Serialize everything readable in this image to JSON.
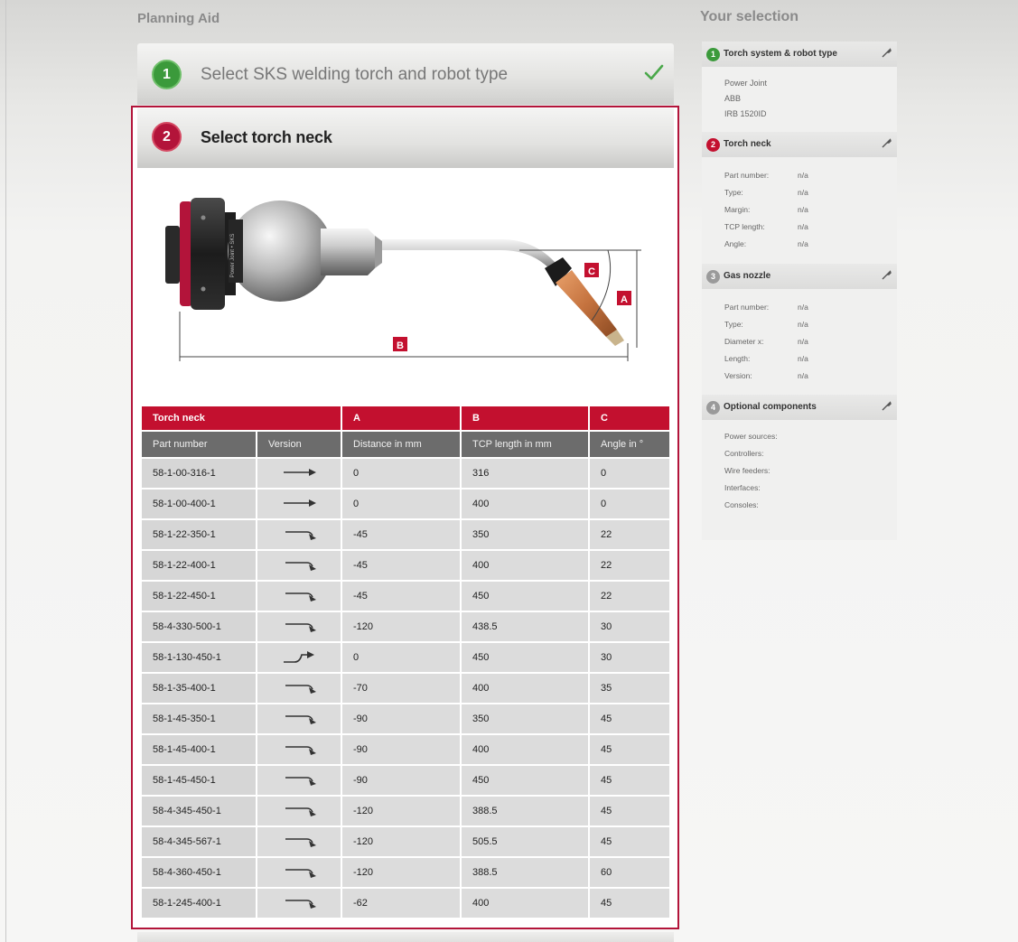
{
  "planning_aid": {
    "title": "Planning Aid"
  },
  "steps": [
    {
      "number": "1",
      "label": "Select SKS welding torch and robot type",
      "status": "completed"
    },
    {
      "number": "2",
      "label": "Select torch neck",
      "status": "active"
    }
  ],
  "diagram": {
    "labels": [
      "A",
      "B",
      "C"
    ],
    "torch_brand_text": "Power Joint • SKS"
  },
  "table": {
    "group_headers": [
      "Torch neck",
      "A",
      "B",
      "C"
    ],
    "column_headers": [
      "Part number",
      "Version",
      "Distance in mm",
      "TCP length in mm",
      "Angle in °"
    ],
    "rows": [
      {
        "part": "58-1-00-316-1",
        "version_icon": "straight-neck-icon",
        "a": "0",
        "b": "316",
        "c": "0"
      },
      {
        "part": "58-1-00-400-1",
        "version_icon": "straight-neck-icon",
        "a": "0",
        "b": "400",
        "c": "0"
      },
      {
        "part": "58-1-22-350-1",
        "version_icon": "bent-neck-icon",
        "a": "-45",
        "b": "350",
        "c": "22"
      },
      {
        "part": "58-1-22-400-1",
        "version_icon": "bent-neck-icon",
        "a": "-45",
        "b": "400",
        "c": "22"
      },
      {
        "part": "58-1-22-450-1",
        "version_icon": "bent-neck-icon",
        "a": "-45",
        "b": "450",
        "c": "22"
      },
      {
        "part": "58-4-330-500-1",
        "version_icon": "bent-neck-icon",
        "a": "-120",
        "b": "438.5",
        "c": "30"
      },
      {
        "part": "58-1-130-450-1",
        "version_icon": "up-bent-neck-icon",
        "a": "0",
        "b": "450",
        "c": "30"
      },
      {
        "part": "58-1-35-400-1",
        "version_icon": "bent-neck-icon",
        "a": "-70",
        "b": "400",
        "c": "35"
      },
      {
        "part": "58-1-45-350-1",
        "version_icon": "bent-neck-icon",
        "a": "-90",
        "b": "350",
        "c": "45"
      },
      {
        "part": "58-1-45-400-1",
        "version_icon": "bent-neck-icon",
        "a": "-90",
        "b": "400",
        "c": "45"
      },
      {
        "part": "58-1-45-450-1",
        "version_icon": "bent-neck-icon",
        "a": "-90",
        "b": "450",
        "c": "45"
      },
      {
        "part": "58-4-345-450-1",
        "version_icon": "bent-neck-icon",
        "a": "-120",
        "b": "388.5",
        "c": "45"
      },
      {
        "part": "58-4-345-567-1",
        "version_icon": "bent-neck-icon",
        "a": "-120",
        "b": "505.5",
        "c": "45"
      },
      {
        "part": "58-4-360-450-1",
        "version_icon": "bent-neck-icon",
        "a": "-120",
        "b": "388.5",
        "c": "60"
      },
      {
        "part": "58-1-245-400-1",
        "version_icon": "bent-neck-icon",
        "a": "-62",
        "b": "400",
        "c": "45"
      }
    ]
  },
  "selection": {
    "title": "Your selection",
    "sections": [
      {
        "number": "1",
        "title": "Torch system & robot type",
        "lines": [
          "Power Joint",
          "ABB",
          "IRB 1520ID"
        ]
      },
      {
        "number": "2",
        "title": "Torch neck",
        "fields": [
          {
            "key": "Part number:",
            "value": "n/a"
          },
          {
            "key": "Type:",
            "value": "n/a"
          },
          {
            "key": "Margin:",
            "value": "n/a"
          },
          {
            "key": "TCP length:",
            "value": "n/a"
          },
          {
            "key": "Angle:",
            "value": "n/a"
          }
        ]
      },
      {
        "number": "3",
        "title": "Gas nozzle",
        "fields": [
          {
            "key": "Part number:",
            "value": "n/a"
          },
          {
            "key": "Type:",
            "value": "n/a"
          },
          {
            "key": "Diameter x:",
            "value": "n/a"
          },
          {
            "key": "Length:",
            "value": "n/a"
          },
          {
            "key": "Version:",
            "value": "n/a"
          }
        ]
      },
      {
        "number": "4",
        "title": "Optional components",
        "lines": [
          "Power sources:",
          "Controllers:",
          "Wire feeders:",
          "Interfaces:",
          "Consoles:"
        ]
      }
    ]
  },
  "colors": {
    "accent_red": "#c3102f",
    "step_done_green": "#3b9a3b",
    "frame_red": "#b3143a",
    "inactive_grey": "#9a9a9a"
  }
}
